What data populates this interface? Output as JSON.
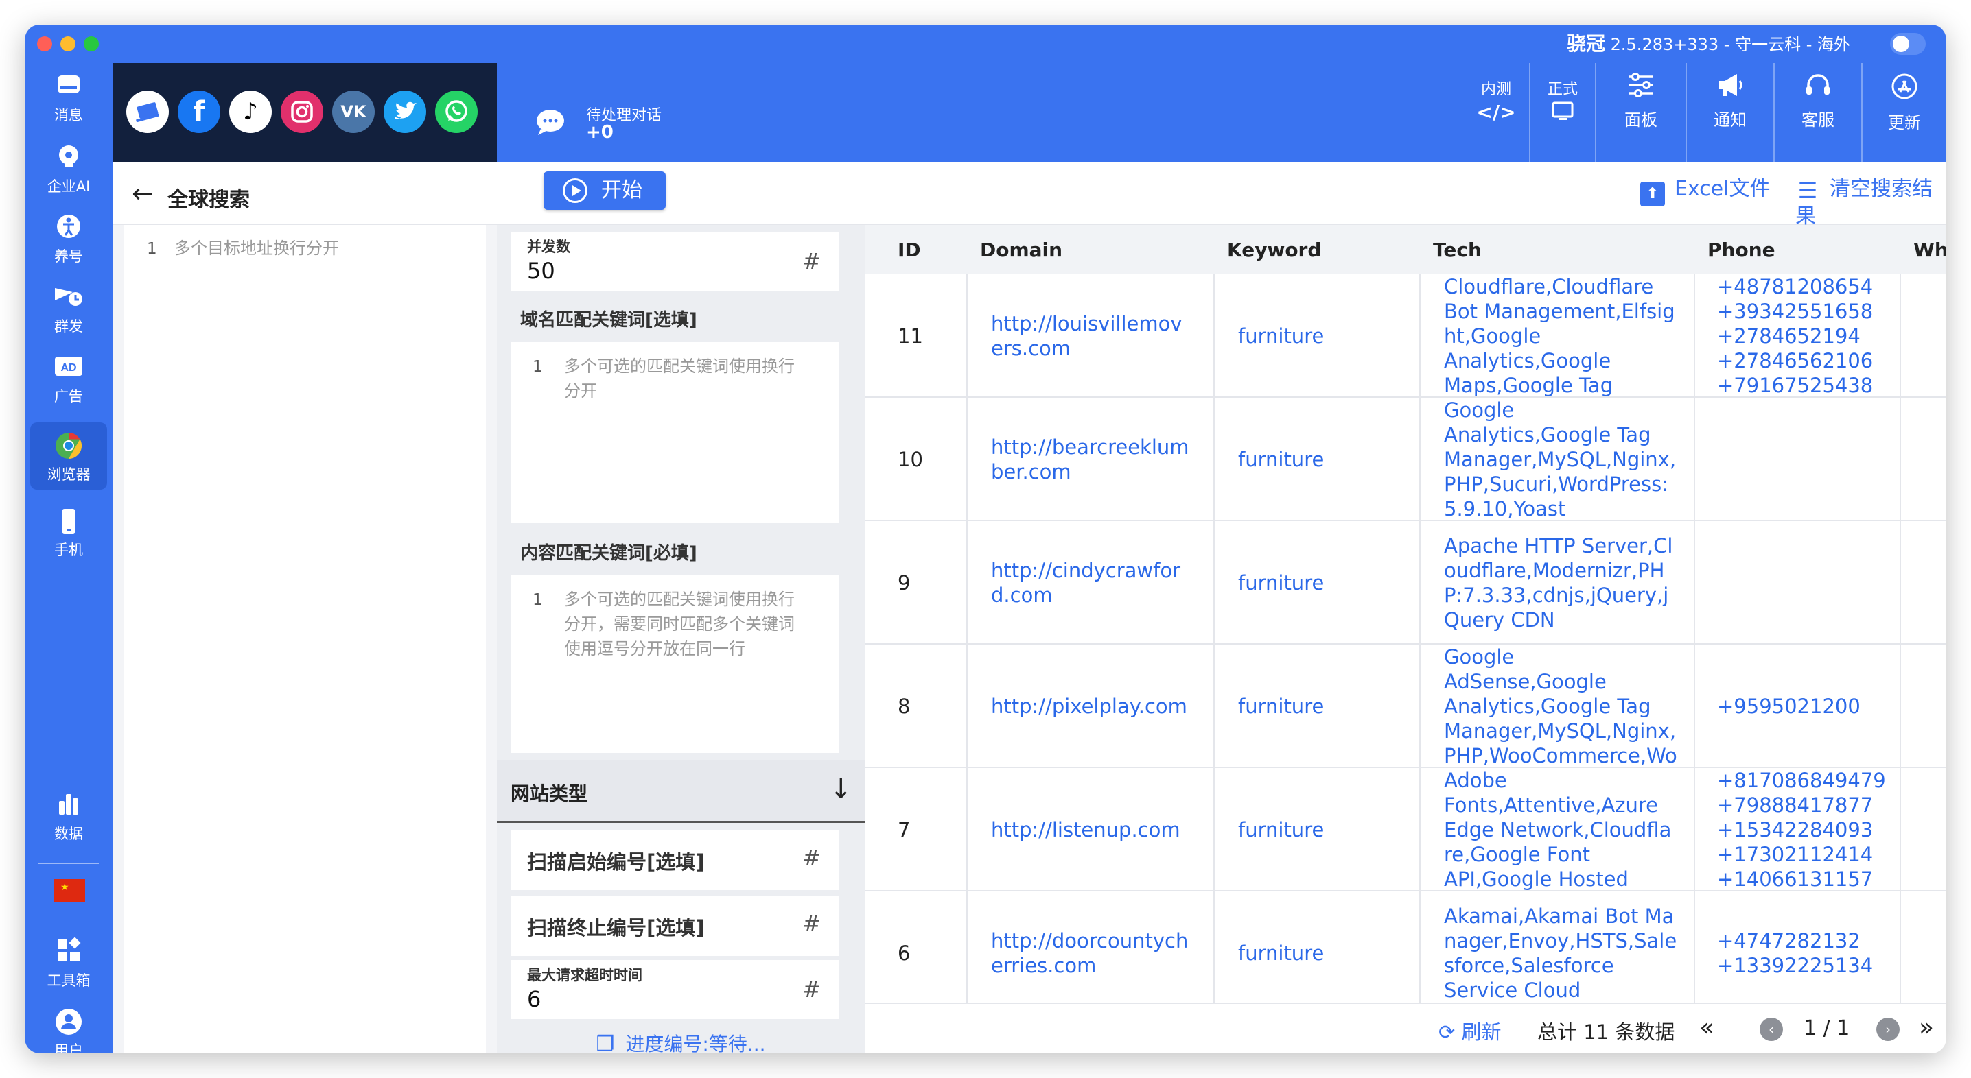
{
  "window": {
    "app_name": "骁冠",
    "version_text": "2.5.283+333 - 守一云科 - 海外"
  },
  "sidebar": {
    "items": [
      {
        "label": "消息",
        "icon": "inbox-icon"
      },
      {
        "label": "企业AI",
        "icon": "ai-brain-icon"
      },
      {
        "label": "养号",
        "icon": "figure-icon"
      },
      {
        "label": "群发",
        "icon": "broadcast-icon"
      },
      {
        "label": "广告",
        "icon": "ad-icon"
      },
      {
        "label": "浏览器",
        "icon": "chrome-icon"
      },
      {
        "label": "手机",
        "icon": "phone-icon"
      },
      {
        "label": "数据",
        "icon": "bar-chart-icon"
      },
      {
        "label": "工具箱",
        "icon": "toolbox-icon"
      },
      {
        "label": "用户",
        "icon": "user-icon"
      }
    ],
    "active": "浏览器"
  },
  "social": [
    "laptop-app-icon",
    "facebook-icon",
    "tiktok-icon",
    "instagram-icon",
    "vk-icon",
    "twitter-icon",
    "whatsapp-icon"
  ],
  "topbar": {
    "pending_label": "待处理对话",
    "pending_count": "+0",
    "buttons": [
      {
        "top": "内测",
        "label": "</>"
      },
      {
        "top": "正式",
        "label": "▭"
      },
      {
        "label": "面板"
      },
      {
        "label": "通知"
      },
      {
        "label": "客服"
      },
      {
        "label": "更新"
      }
    ]
  },
  "search": {
    "title": "全球搜索",
    "address_line": "1",
    "address_placeholder": "多个目标地址换行分开"
  },
  "actions": {
    "start": "开始",
    "excel": "Excel文件",
    "clear": "清空搜索结果"
  },
  "config": {
    "concurrency_label": "并发数",
    "concurrency_value": "50",
    "domain_kw_label": "域名匹配关键词[选填]",
    "domain_kw_line": "1",
    "domain_kw_placeholder_1": "多个可选的匹配关键词使用换行",
    "domain_kw_placeholder_2": "分开",
    "content_kw_label": "内容匹配关键词[必填]",
    "content_kw_line": "1",
    "content_kw_placeholder_1": "多个可选的匹配关键词使用换行",
    "content_kw_placeholder_2": "分开，需要同时匹配多个关键词",
    "content_kw_placeholder_3": "使用逗号分开放在同一行",
    "site_type": "网站类型",
    "scan_start": "扫描启始编号[选填]",
    "scan_end": "扫描终止编号[选填]",
    "timeout_label": "最大请求超时时间",
    "timeout_value": "6",
    "progress": "进度编号:等待..."
  },
  "table": {
    "columns": [
      "ID",
      "Domain",
      "Keyword",
      "Tech",
      "Phone",
      "Whats"
    ],
    "rows": [
      {
        "id": "11",
        "domain": "http://louisvillemovers.com",
        "keyword": "furniture",
        "tech": [
          "Cloudflare,Cloudflare",
          "Bot Management,Elfsig",
          "ht,Google",
          "Analytics,Google",
          "Maps,Google Tag"
        ],
        "phones": [
          "+48781208654",
          "+39342551658",
          "+2784652194",
          "+27846562106",
          "+79167525438"
        ]
      },
      {
        "id": "10",
        "domain": "http://bearcreeklumber.com",
        "keyword": "furniture",
        "tech": [
          "Google",
          "Analytics,Google Tag",
          "Manager,MySQL,Nginx,",
          "PHP,Sucuri,WordPress:",
          "5.9.10,Yoast"
        ],
        "phones": []
      },
      {
        "id": "9",
        "domain": "http://cindycrawford.com",
        "keyword": "furniture",
        "tech": [
          "Apache HTTP Server,Cl",
          "oudflare,Modernizr,PH",
          "P:7.3.33,cdnjs,jQuery,j",
          "Query CDN"
        ],
        "phones": []
      },
      {
        "id": "8",
        "domain": "http://pixelplay.com",
        "keyword": "furniture",
        "tech": [
          "Google",
          "AdSense,Google",
          "Analytics,Google Tag",
          "Manager,MySQL,Nginx,",
          "PHP,WooCommerce,Wo"
        ],
        "phones": [
          "+9595021200"
        ]
      },
      {
        "id": "7",
        "domain": "http://listenup.com",
        "keyword": "furniture",
        "tech": [
          "Adobe",
          "Fonts,Attentive,Azure",
          "Edge Network,Cloudfla",
          "re,Google Font",
          "API,Google Hosted"
        ],
        "phones": [
          "+817086849479",
          "+79888417877",
          "+15342284093",
          "+17302112414",
          "+14066131157"
        ]
      },
      {
        "id": "6",
        "domain": "http://doorcountycherries.com",
        "keyword": "furniture",
        "tech": [
          "Akamai,Akamai Bot Ma",
          "nager,Envoy,HSTS,Sale",
          "sforce,Salesforce",
          "Service Cloud"
        ],
        "phones": [
          "+4747282132",
          "+13392225134"
        ]
      }
    ]
  },
  "footer": {
    "refresh": "刷新",
    "total": "总计 11 条数据",
    "page": "1 / 1"
  }
}
